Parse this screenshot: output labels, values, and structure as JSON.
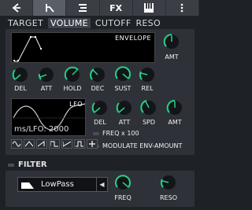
{
  "tabs": [
    {
      "label": "TARGET"
    },
    {
      "label": "VOLUME"
    },
    {
      "label": "CUTOFF"
    },
    {
      "label": "RESO"
    }
  ],
  "envelope": {
    "label": "ENVELOPE",
    "amt_label": "AMT",
    "knobs": [
      {
        "label": "DEL"
      },
      {
        "label": "ATT"
      },
      {
        "label": "HOLD"
      },
      {
        "label": "DEC"
      },
      {
        "label": "SUST"
      },
      {
        "label": "REL"
      }
    ]
  },
  "lfo": {
    "label": "LFO",
    "rate_text": "ms/LFO: 2000",
    "knobs": [
      {
        "label": "DEL"
      },
      {
        "label": "ATT"
      },
      {
        "label": "SPD"
      },
      {
        "label": "AMT"
      }
    ],
    "freq_x100": "FREQ x 100",
    "modulate": "MODULATE ENV-AMOUNT"
  },
  "filter": {
    "title": "FILTER",
    "type": "LowPass",
    "freq_label": "FREQ",
    "reso_label": "RESO"
  },
  "colors": {
    "accent": "#27d08a",
    "background": "#1e2126",
    "panel": "#2e3238"
  },
  "toolbar_icons": [
    "arrow-left-icon",
    "envelope-shape-icon",
    "eq-bars-icon",
    "fx-text",
    "piano-icon",
    "menu-dots-icon"
  ],
  "toolbar_fx": "FX"
}
